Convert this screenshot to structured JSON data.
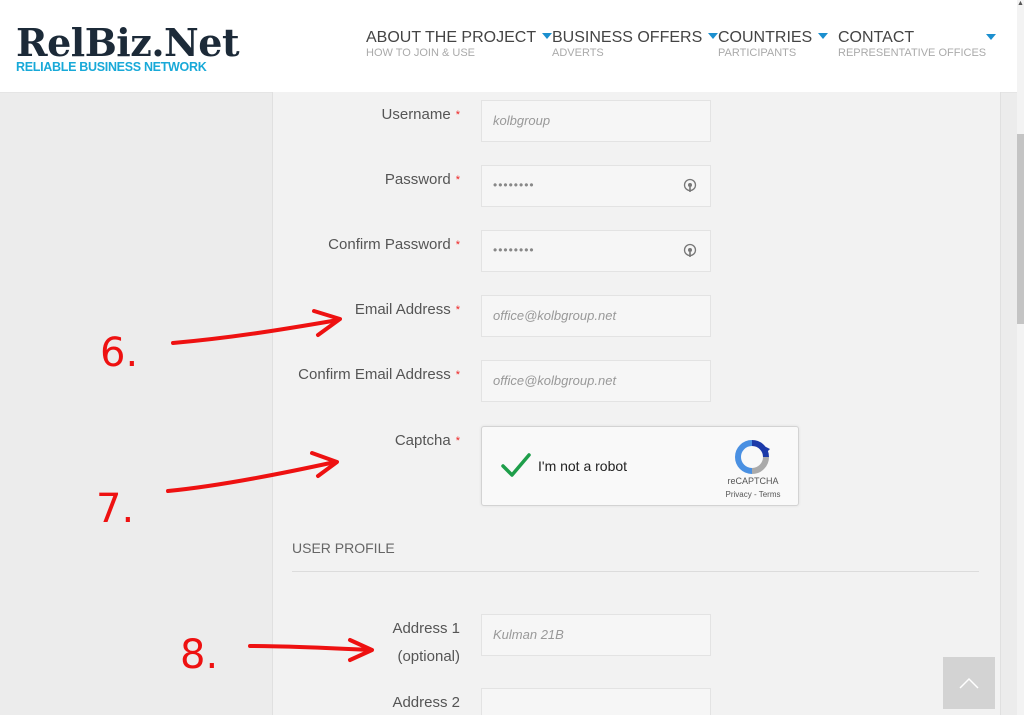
{
  "logo": {
    "name": "RelBiz.Net",
    "tagline": "RELIABLE BUSINESS NETWORK"
  },
  "nav": [
    {
      "title": "ABOUT THE PROJECT",
      "sub": "HOW TO JOIN & USE"
    },
    {
      "title": "BUSINESS OFFERS",
      "sub": "ADVERTS"
    },
    {
      "title": "COUNTRIES",
      "sub": "PARTICIPANTS"
    },
    {
      "title": "CONTACT",
      "sub": "REPRESENTATIVE OFFICES"
    }
  ],
  "form": {
    "required_mark": "*",
    "username": {
      "label": "Username",
      "value": "kolbgroup"
    },
    "password": {
      "label": "Password",
      "value": "••••••••"
    },
    "confirm_password": {
      "label": "Confirm Password",
      "value": "••••••••"
    },
    "email": {
      "label": "Email Address",
      "value": "office@kolbgroup.net"
    },
    "confirm_email": {
      "label": "Confirm Email Address",
      "value": "office@kolbgroup.net"
    },
    "captcha": {
      "label": "Captcha",
      "checkbox_text": "I'm not a robot",
      "brand": "reCAPTCHA",
      "terms": "Privacy - Terms",
      "checked": true
    },
    "section_title": "USER PROFILE",
    "address1": {
      "label_line1": "Address 1",
      "label_line2": "(optional)",
      "value": "Kulman 21B"
    },
    "address2": {
      "label": "Address 2",
      "value": ""
    }
  },
  "annotations": {
    "six": "6.",
    "seven": "7.",
    "eight": "8."
  },
  "colors": {
    "accent": "#1b8fcf",
    "logo_blue": "#18a9d8",
    "required": "#ee2222",
    "annotation": "#ee1111",
    "check": "#1e9e4a"
  }
}
